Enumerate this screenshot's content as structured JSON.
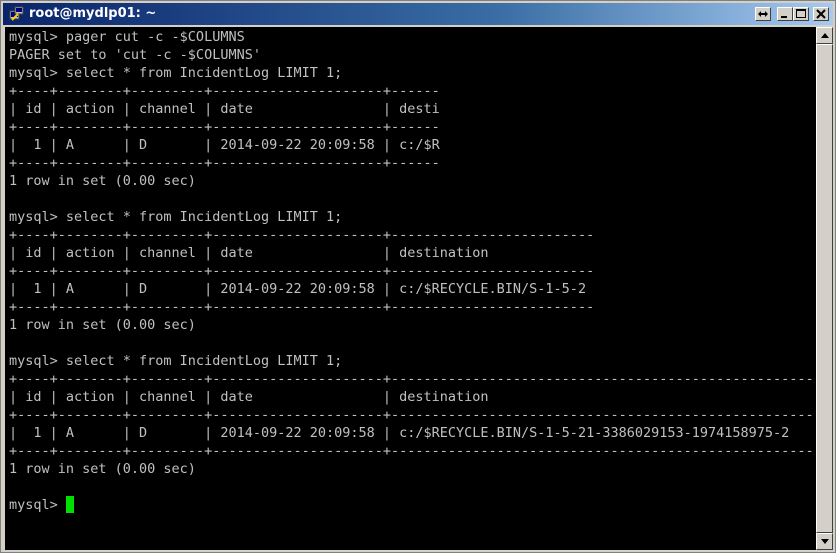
{
  "window": {
    "title": "root@mydlp01: ~",
    "icon": "putty-icon"
  },
  "terminal": {
    "lines": [
      "mysql> pager cut -c -$COLUMNS",
      "PAGER set to 'cut -c -$COLUMNS'",
      "mysql> select * from IncidentLog LIMIT 1;",
      "+----+--------+---------+---------------------+------",
      "| id | action | channel | date                | desti",
      "+----+--------+---------+---------------------+------",
      "|  1 | A      | D       | 2014-09-22 20:09:58 | c:/$R",
      "+----+--------+---------+---------------------+------",
      "1 row in set (0.00 sec)",
      "",
      "mysql> select * from IncidentLog LIMIT 1;",
      "+----+--------+---------+---------------------+-------------------------",
      "| id | action | channel | date                | destination",
      "+----+--------+---------+---------------------+-------------------------",
      "|  1 | A      | D       | 2014-09-22 20:09:58 | c:/$RECYCLE.BIN/S-1-5-2",
      "+----+--------+---------+---------------------+-------------------------",
      "1 row in set (0.00 sec)",
      "",
      "mysql> select * from IncidentLog LIMIT 1;",
      "+----+--------+---------+---------------------+-----------------------------------------------------",
      "| id | action | channel | date                | destination",
      "+----+--------+---------+---------------------+-----------------------------------------------------",
      "|  1 | A      | D       | 2014-09-22 20:09:58 | c:/$RECYCLE.BIN/S-1-5-21-3386029153-1974158975-2",
      "+----+--------+---------+---------------------+-----------------------------------------------------",
      "1 row in set (0.00 sec)",
      ""
    ],
    "prompt": "mysql> "
  },
  "colors": {
    "background": "#000000",
    "text": "#c0c0c0",
    "cursor": "#00e000",
    "titlebar_start": "#0a246a",
    "titlebar_end": "#a6caf0"
  }
}
